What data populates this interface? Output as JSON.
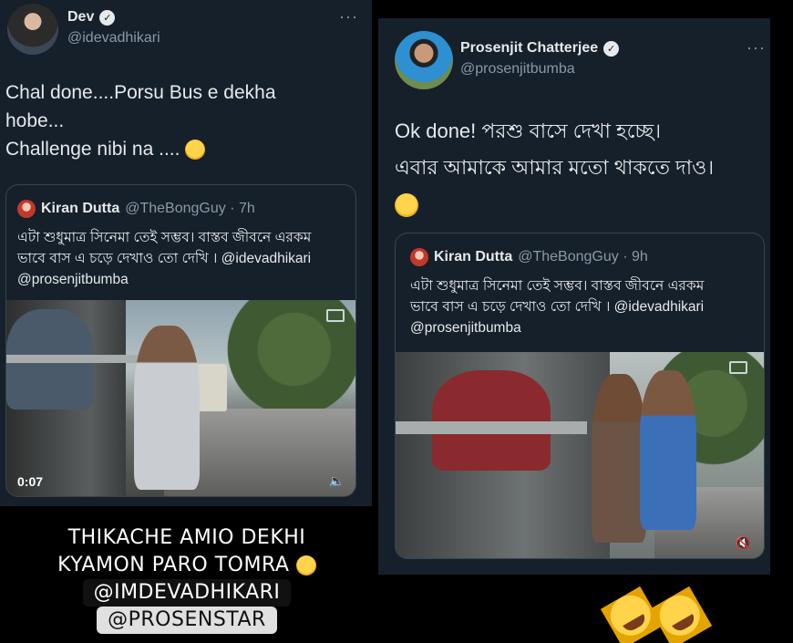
{
  "left_tweet": {
    "name": "Dev",
    "handle": "@idevadhikari",
    "more": "···",
    "text_lines": [
      "Chal done....Porsu Bus e dekha",
      "hobe...",
      "Challenge nibi na ...."
    ],
    "emoji": "winking-face",
    "quote": {
      "name": "Kiran Dutta",
      "handle_time": "@TheBongGuy · 7h",
      "text_lines": [
        "এটা শুধুমাত্র সিনেমা তেই সম্ভব। বাস্তব জীবনে এরকম",
        "ভাবে বাস এ চড়ে দেখাও তো দেখি । @idevadhikari",
        "@prosenjitbumba"
      ],
      "video_time": "0:07",
      "volume_icon": "🔈"
    }
  },
  "right_tweet": {
    "name": "Prosenjit Chatterjee",
    "handle": "@prosenjitbumba",
    "more": "···",
    "text_lines": [
      "Ok done! পরশু বাসে দেখা হচ্ছে।",
      "এবার আমাকে আমার মতো থাকতে দাও।"
    ],
    "emoji": "laughing-face",
    "quote": {
      "name": "Kiran Dutta",
      "handle_time": "@TheBongGuy · 9h",
      "text_lines": [
        "এটা শুধুমাত্র সিনেমা তেই সম্ভব। বাস্তব জীবনে এরকম",
        "ভাবে বাস এ চড়ে দেখাও তো দেখি । @idevadhikari",
        "@prosenjitbumba"
      ],
      "mute_icon": "🔇"
    }
  },
  "caption": {
    "lines": [
      "THIKACHE AMIO DEKHI",
      "KYAMON PARO TOMRA",
      "@IMDEVADHIKARI",
      "@PROSENSTAR"
    ]
  },
  "reactions": [
    "rolling-on-floor-laughing",
    "rolling-on-floor-laughing"
  ],
  "colors": {
    "panel": "#15202b",
    "text": "#e7e9ea",
    "muted": "#8b98a5",
    "border": "#38444d"
  }
}
